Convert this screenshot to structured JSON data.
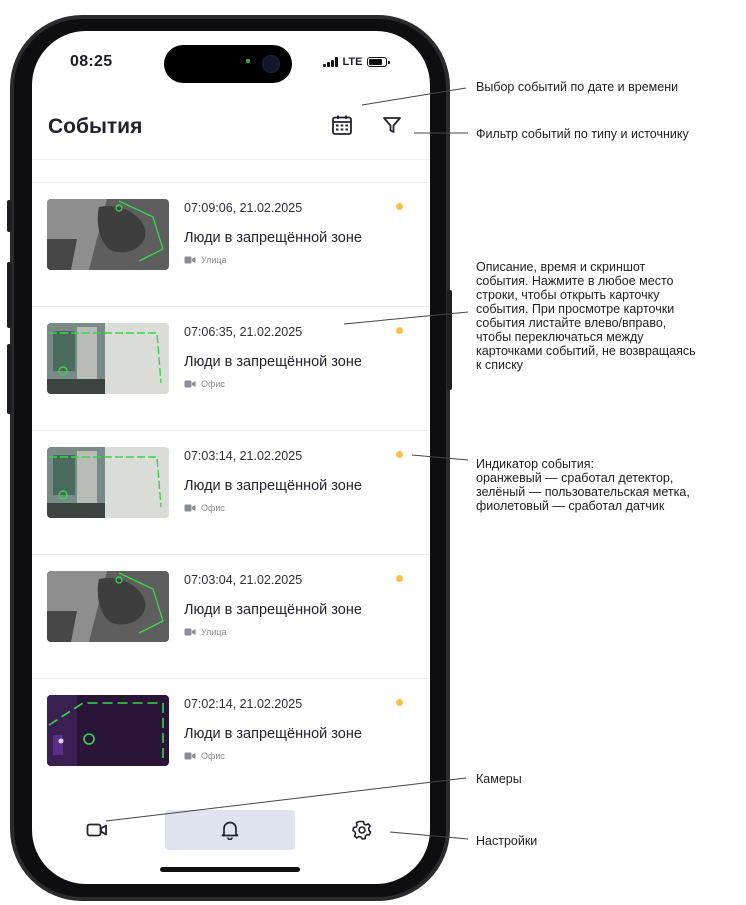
{
  "status_bar": {
    "time": "08:25",
    "network": "LTE"
  },
  "header": {
    "title": "События",
    "calendar_icon": "calendar-icon",
    "filter_icon": "filter-icon"
  },
  "events": [
    {
      "time": "07:09:06, 21.02.2025",
      "title": "Люди в запрещённой зоне",
      "camera": "Улица",
      "indicator_color": "#f6c14b",
      "thumb_style": "night"
    },
    {
      "time": "07:06:35, 21.02.2025",
      "title": "Люди в запрещённой зоне",
      "camera": "Офис",
      "indicator_color": "#f6c14b",
      "thumb_style": "office"
    },
    {
      "time": "07:03:14, 21.02.2025",
      "title": "Люди в запрещённой зоне",
      "camera": "Офис",
      "indicator_color": "#f6c14b",
      "thumb_style": "office"
    },
    {
      "time": "07:03:04, 21.02.2025",
      "title": "Люди в запрещённой зоне",
      "camera": "Улица",
      "indicator_color": "#f6c14b",
      "thumb_style": "night"
    },
    {
      "time": "07:02:14, 21.02.2025",
      "title": "Люди в запрещённой зоне",
      "camera": "Офис",
      "indicator_color": "#f6c14b",
      "thumb_style": "dark-office"
    }
  ],
  "bottom_nav": [
    {
      "name": "cameras",
      "icon": "video-camera-icon",
      "active": false
    },
    {
      "name": "events",
      "icon": "bell-icon",
      "active": true
    },
    {
      "name": "settings",
      "icon": "gear-icon",
      "active": false
    }
  ],
  "annotations": {
    "date_filter": "Выбор событий по дате и времени",
    "type_filter": "Фильтр событий по типу и источнику",
    "description": [
      "Описание, время и скриншот",
      "события. Нажмите в любое место",
      "строки, чтобы открыть карточку",
      "события. При просмотре карточки",
      "события листайте влево/вправо,",
      "чтобы переключаться между",
      "карточками событий, не возвращаясь",
      "к списку"
    ],
    "indicator": [
      "Индикатор события:",
      "оранжевый — сработал детектор,",
      "зелёный — пользовательская метка,",
      "фиолетовый — сработал датчик"
    ],
    "cameras": "Камеры",
    "settings": "Настройки"
  }
}
